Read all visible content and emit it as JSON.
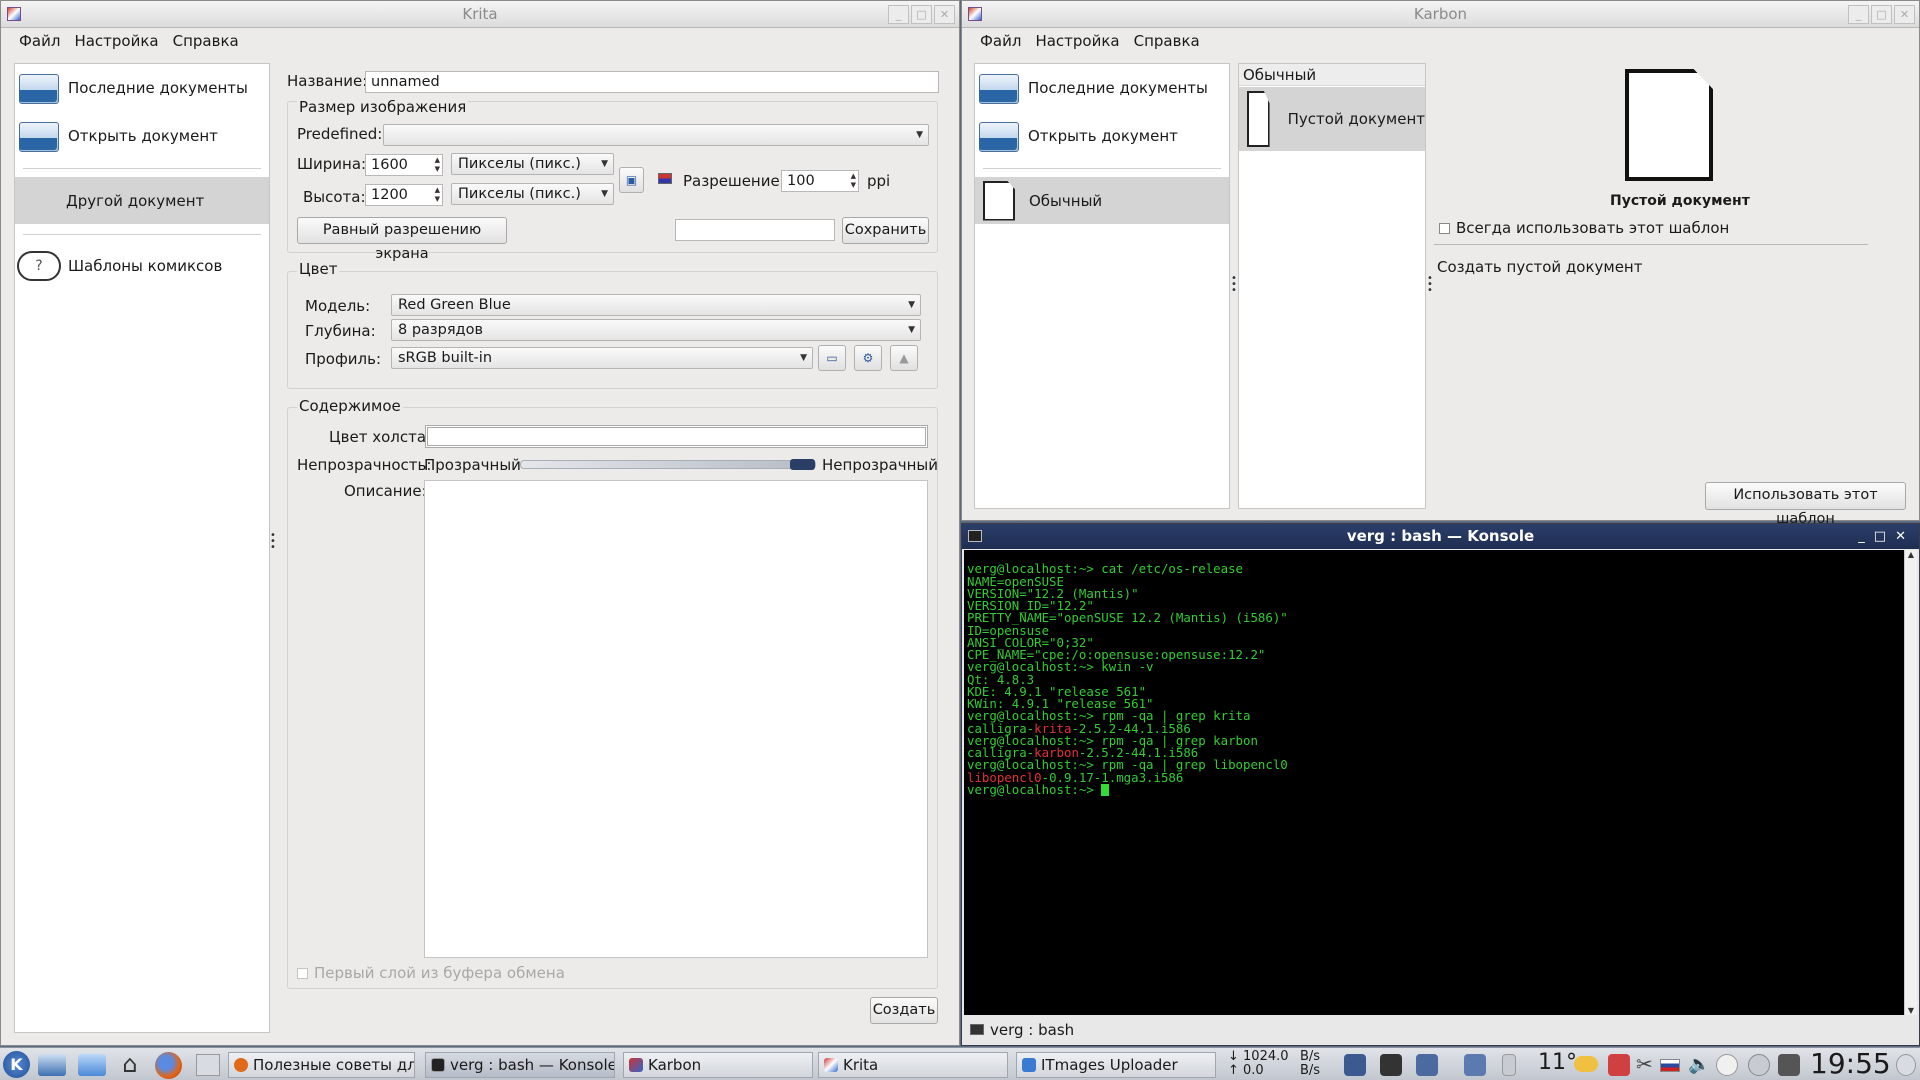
{
  "krita": {
    "title": "Krita",
    "menu": [
      "Файл",
      "Настройка",
      "Справка"
    ],
    "nav": {
      "recent": "Последние документы",
      "open": "Открыть документ",
      "custom": "Другой документ",
      "comics": "Шаблоны комиксов"
    },
    "name_label": "Название:",
    "name_value": "unnamed",
    "size_group": "Размер изображения",
    "predefined_label": "Predefined:",
    "predefined_value": "",
    "width_label": "Ширина:",
    "width_value": "1600",
    "height_label": "Высота:",
    "height_value": "1200",
    "unit_value": "Пикселы (пикс.)",
    "resolution_label": "Разрешение:",
    "resolution_value": "100",
    "resolution_unit": "ppi",
    "screen_res_button": "Равный разрешению экрана",
    "preset_name_value": "",
    "save_button": "Сохранить",
    "color_group": "Цвет",
    "model_label": "Модель:",
    "model_value": "Red Green Blue",
    "depth_label": "Глубина:",
    "depth_value": "8 разрядов",
    "profile_label": "Профиль:",
    "profile_value": "sRGB built-in",
    "content_group": "Содержимое",
    "canvas_color_label": "Цвет холста:",
    "opacity_label": "Непрозрачность:",
    "opacity_min": "Прозрачный",
    "opacity_max": "Непрозрачный",
    "opacity_level": 1.0,
    "description_label": "Описание:",
    "clipboard_checkbox": "Первый слой из буфера обмена",
    "create_button": "Создать"
  },
  "karbon": {
    "title": "Karbon",
    "menu": [
      "Файл",
      "Настройка",
      "Справка"
    ],
    "nav": {
      "recent": "Последние документы",
      "open": "Открыть документ",
      "normal": "Обычный"
    },
    "templates_header": "Обычный",
    "template_item": "Пустой документ",
    "preview_title": "Пустой документ",
    "always_use_checkbox": "Всегда использовать этот шаблон",
    "description": "Создать пустой документ",
    "use_template_button": "Использовать этот шаблон"
  },
  "konsole": {
    "title": "verg : bash — Konsole",
    "tab_label": "verg : bash",
    "lines": [
      "verg@localhost:~> cat /etc/os-release",
      "NAME=openSUSE",
      "VERSION=\"12.2 (Mantis)\"",
      "VERSION_ID=\"12.2\"",
      "PRETTY_NAME=\"openSUSE 12.2 (Mantis) (i586)\"",
      "ID=opensuse",
      "ANSI_COLOR=\"0;32\"",
      "CPE_NAME=\"cpe:/o:opensuse:opensuse:12.2\"",
      "verg@localhost:~> kwin -v",
      "Qt: 4.8.3",
      "KDE: 4.9.1 \"release 561\"",
      "KWin: 4.9.1 \"release 561\"",
      "verg@localhost:~> rpm -qa | grep krita"
    ],
    "line_krita_pre": "calligra-",
    "line_krita_hl": "krita",
    "line_krita_post": "-2.5.2-44.1.i586",
    "line_prompt_karbon": "verg@localhost:~> rpm -qa | grep karbon",
    "line_karbon_pre": "calligra-",
    "line_karbon_hl": "karbon",
    "line_karbon_post": "-2.5.2-44.1.i586",
    "line_prompt_lib": "verg@localhost:~> rpm -qa | grep libopencl0",
    "line_lib_hl": "libopencl0",
    "line_lib_post": "-0.9.17-1.mga3.i586",
    "prompt": "verg@localhost:~> "
  },
  "taskbar": {
    "tasks": [
      "Полезные советы для",
      "verg : bash — Konsole",
      "Karbon",
      "Krita",
      "ITmages Uploader"
    ],
    "net_down": "↓ 1024.0",
    "net_down_unit": "B/s",
    "net_up": "↑      0.0",
    "net_up_unit": "B/s",
    "temperature": "11°",
    "clock": "19:55"
  }
}
